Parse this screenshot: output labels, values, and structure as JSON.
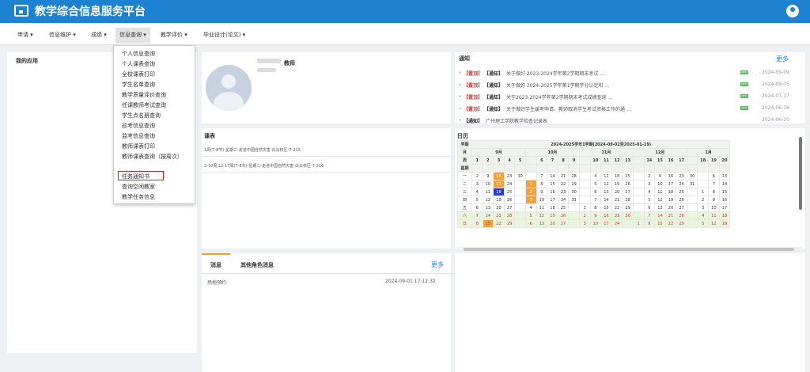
{
  "header": {
    "title": "教学综合信息服务平台"
  },
  "nav": [
    {
      "label": "申请 ▾"
    },
    {
      "label": "信息维护 ▾"
    },
    {
      "label": "成绩 ▾"
    },
    {
      "label": "信息查询 ▾"
    },
    {
      "label": "教学评价 ▾"
    },
    {
      "label": "毕业设计(论文) ▾"
    }
  ],
  "dropdown": [
    "个人信息查询",
    "个人课表查询",
    "全校课表打印",
    "学生名单查询",
    "教学质量评价查询",
    "任课教师考试查询",
    "学生点名册查询",
    "巡考信息查询",
    "监考信息查询",
    "教师课表打印",
    "教师课表查询（按周次）",
    "任务通知书",
    "查询空闲教室",
    "教学任务信息"
  ],
  "apps": {
    "title": "我的应用"
  },
  "profile": {
    "role": "教师"
  },
  "notices": {
    "title": "通知",
    "more": "更多",
    "items": [
      {
        "tag": "【置顶】",
        "type": "【通知】",
        "text": "关于做好 2023-2024学年第2学期期末考试 …",
        "date": "2024-09-09",
        "new": "NEW"
      },
      {
        "tag": "【置顶】",
        "type": "【通知】",
        "text": "关于做好 2024-2025学年第1学期学分认定和 …",
        "date": "2024-09-05",
        "new": "NEW"
      },
      {
        "tag": "【置顶】",
        "type": "【通知】",
        "text": "关于2023-2024学年第2学期期末考试成绩查询 …",
        "date": "2024-07-17",
        "new": "NEW"
      },
      {
        "tag": "【置顶】",
        "type": "【通知】",
        "text": "关于做好学生缓考申请、教师取消学生考试资格工作的通 …",
        "date": "2024-06-18",
        "new": "NEW"
      },
      {
        "tag": "",
        "type": "【通知】",
        "text": "广州理工学院教学检查记录表",
        "date": "2024-06-20",
        "new": ""
      }
    ]
  },
  "schedule": {
    "title": "课表",
    "rows": [
      "1周(7-8节)-星期二-走进中国自然灾害-白云校区-7-215",
      "2-10周,12-17周(7-8节)-星期二-走进中国自然灾害-白云校区-7-216"
    ]
  },
  "calendar": {
    "title": "日历",
    "corner": [
      "学期",
      "月",
      "周",
      "星期"
    ],
    "term": "2024-2025学年1学期(2024-09-02至2025-01-19)",
    "months": [
      "9月",
      "10月",
      "11月",
      "12月",
      "1月"
    ],
    "weeks": [
      "1",
      "2",
      "3",
      "4",
      "5",
      "6",
      "7",
      "8",
      "9",
      "10",
      "11",
      "12",
      "13",
      "14",
      "15",
      "16",
      "17",
      "18",
      "19",
      "20"
    ],
    "rows": [
      {
        "day": "一",
        "cells": [
          "2",
          "9",
          "16",
          "23",
          "30",
          "",
          "7",
          "14",
          "21",
          "28",
          "",
          "4",
          "11",
          "18",
          "25",
          "",
          "2",
          "9",
          "16",
          "23",
          "30",
          "",
          "6",
          "13"
        ]
      },
      {
        "day": "二",
        "cells": [
          "3",
          "10",
          "17",
          "24",
          "",
          "1",
          "8",
          "15",
          "22",
          "29",
          "",
          "5",
          "12",
          "19",
          "26",
          "",
          "3",
          "10",
          "17",
          "24",
          "31",
          "",
          "7",
          "14"
        ]
      },
      {
        "day": "三",
        "cells": [
          "4",
          "11",
          "18",
          "25",
          "",
          "2",
          "9",
          "16",
          "23",
          "30",
          "",
          "6",
          "13",
          "20",
          "27",
          "",
          "4",
          "11",
          "18",
          "25",
          "",
          "1",
          "8",
          "15"
        ]
      },
      {
        "day": "四",
        "cells": [
          "5",
          "12",
          "19",
          "26",
          "",
          "3",
          "10",
          "17",
          "24",
          "31",
          "",
          "7",
          "14",
          "21",
          "28",
          "",
          "5",
          "12",
          "19",
          "26",
          "",
          "2",
          "9",
          "16"
        ]
      },
      {
        "day": "五",
        "cells": [
          "6",
          "13",
          "20",
          "27",
          "",
          "4",
          "11",
          "18",
          "25",
          "",
          "1",
          "8",
          "15",
          "22",
          "29",
          "",
          "6",
          "13",
          "20",
          "27",
          "",
          "3",
          "10",
          "17"
        ]
      },
      {
        "day": "六",
        "cells": [
          "7",
          "14",
          "21",
          "28",
          "",
          "5",
          "12",
          "19",
          "26",
          "",
          "2",
          "9",
          "16",
          "23",
          "30",
          "",
          "7",
          "14",
          "21",
          "28",
          "",
          "4",
          "11",
          "18"
        ]
      },
      {
        "day": "日",
        "cells": [
          "8",
          "15",
          "22",
          "29",
          "",
          "6",
          "13",
          "20",
          "27",
          "",
          "3",
          "10",
          "17",
          "24",
          "",
          "1",
          "8",
          "15",
          "22",
          "29",
          "",
          "5",
          "12",
          "19"
        ]
      }
    ]
  },
  "messages": {
    "tabs": [
      "消息",
      "其他角色消息"
    ],
    "more": "更多",
    "items": [
      {
        "text": "场地预约",
        "time": "2024-09-01 17:12:32"
      }
    ]
  }
}
